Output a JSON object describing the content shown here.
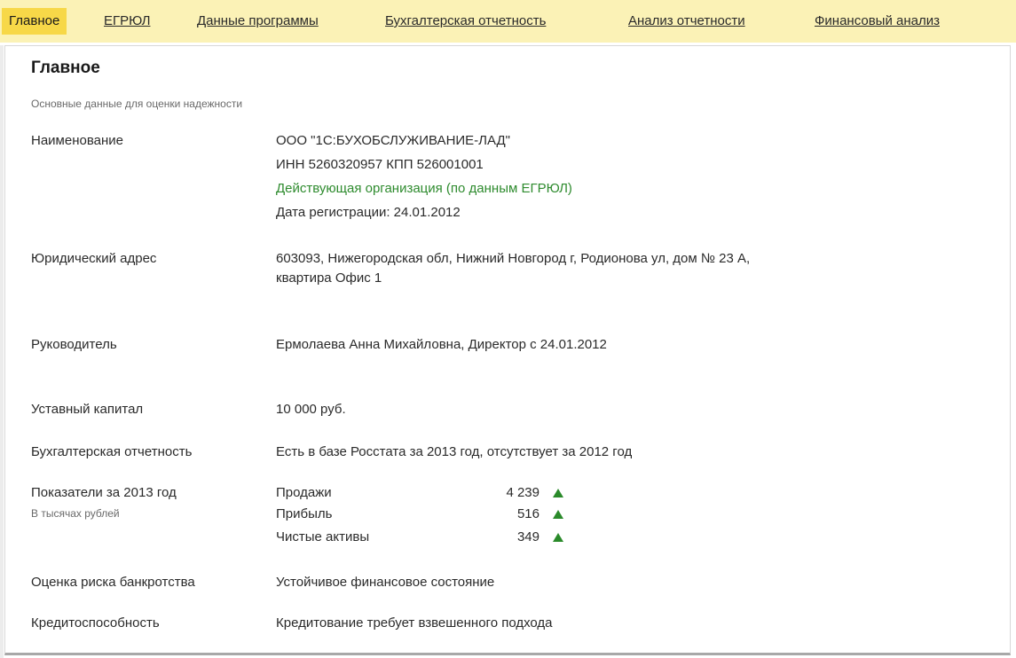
{
  "tabs": [
    {
      "label": "Главное",
      "active": true
    },
    {
      "label": "ЕГРЮЛ",
      "active": false
    },
    {
      "label": "Данные программы",
      "active": false
    },
    {
      "label": "Бухгалтерская отчетность",
      "active": false
    },
    {
      "label": "Анализ отчетности",
      "active": false
    },
    {
      "label": "Финансовый анализ",
      "active": false
    }
  ],
  "page": {
    "title": "Главное",
    "subtitle": "Основные данные для оценки надежности"
  },
  "fields": {
    "name": {
      "label": "Наименование",
      "org": "ООО \"1С:БУХОБСЛУЖИВАНИЕ-ЛАД\"",
      "inn_kpp": "ИНН 5260320957 КПП 526001001",
      "status": "Действующая организация (по данным ЕГРЮЛ)",
      "reg_date": "Дата регистрации: 24.01.2012"
    },
    "address": {
      "label": "Юридический адрес",
      "line1": "603093, Нижегородская обл, Нижний Новгород г, Родионова ул, дом № 23 А,",
      "line2": "квартира Офис 1"
    },
    "head": {
      "label": "Руководитель",
      "value": "Ермолаева Анна Михайловна, Директор с 24.01.2012"
    },
    "capital": {
      "label": "Уставный капитал",
      "value": "10 000 руб."
    },
    "reporting": {
      "label": "Бухгалтерская отчетность",
      "value": "Есть в базе Росстата за 2013 год, отсутствует за 2012 год"
    },
    "indicators": {
      "label": "Показатели за 2013 год",
      "sublabel": "В тысячах рублей",
      "items": [
        {
          "name": "Продажи",
          "value": "4 239",
          "trend": "up"
        },
        {
          "name": "Прибыль",
          "value": "516",
          "trend": "up"
        },
        {
          "name": "Чистые активы",
          "value": "349",
          "trend": "up"
        }
      ]
    },
    "bankruptcy": {
      "label": "Оценка риска банкротства",
      "value": "Устойчивое финансовое состояние"
    },
    "credit": {
      "label": "Кредитоспособность",
      "value": "Кредитование требует взвешенного подхода"
    }
  },
  "colors": {
    "tabbar_bg": "#fbf2b6",
    "active_tab_bg": "#f7d848",
    "status_green": "#2e8b2e",
    "trend_up": "#2a8a2a"
  }
}
